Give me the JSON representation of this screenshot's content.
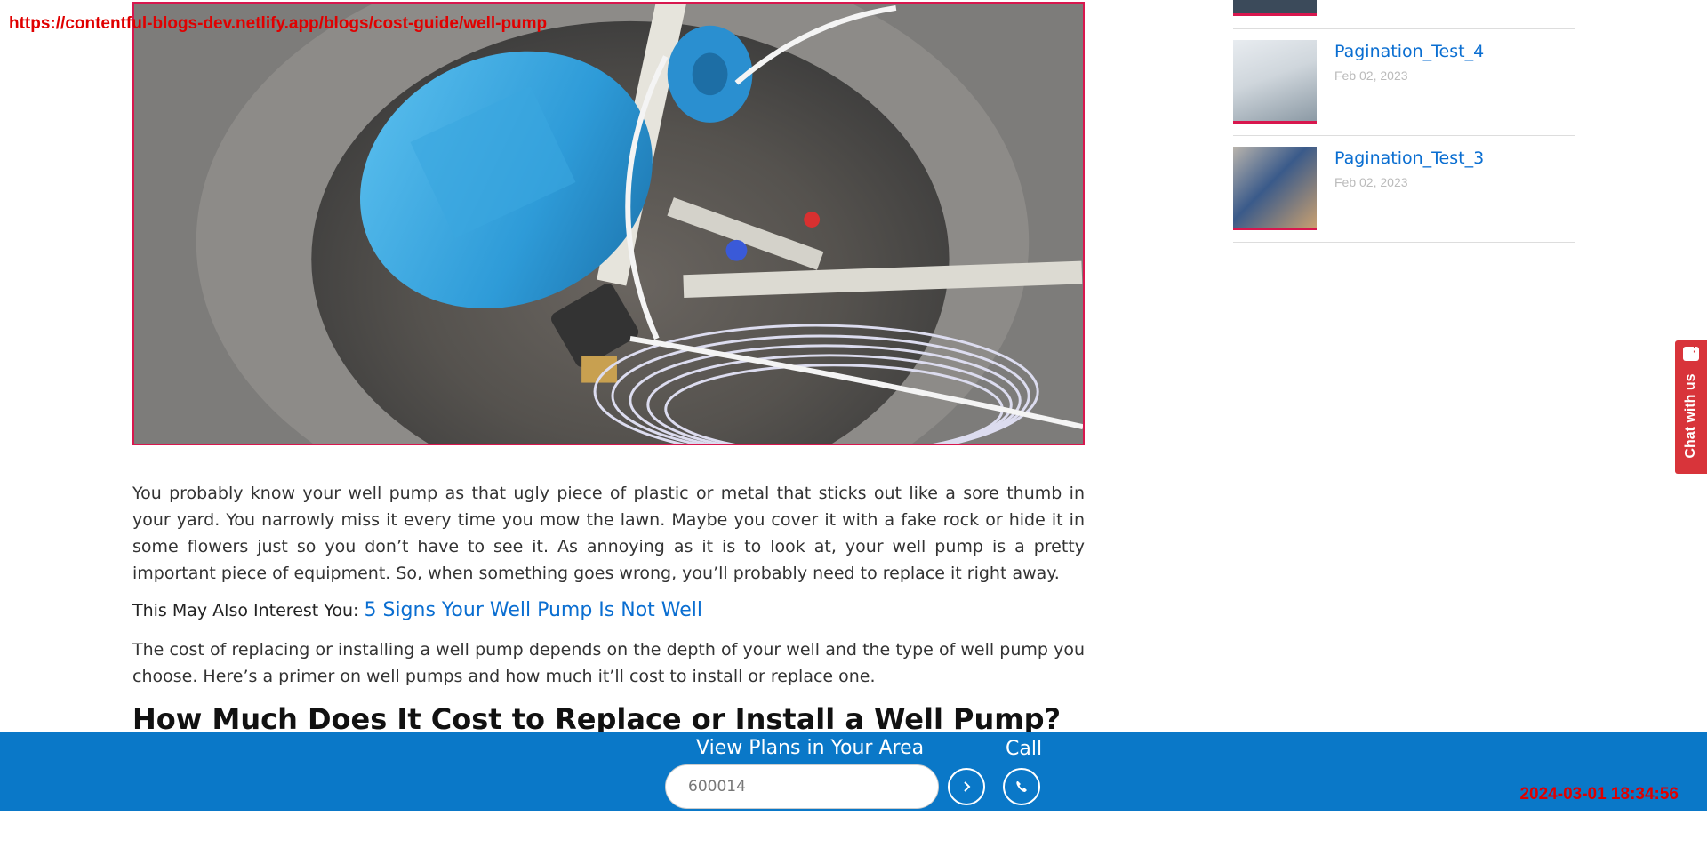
{
  "browser": {
    "url": "https://contentful-blogs-dev.netlify.app/blogs/cost-guide/well-pump",
    "timestamp": "2024-03-01 18:34:56"
  },
  "article": {
    "paragraph1": "You probably know your well pump as that ugly piece of plastic or metal that sticks out like a sore thumb in your yard. You narrowly miss it every time you mow the lawn. Maybe you cover it with a fake rock or hide it in some flowers just so you don’t have to see it. As annoying as it is to look at, your well pump is a pretty important piece of equipment. So, when something goes wrong, you’ll probably need to replace it right away.",
    "interest_label": "This May Also Interest You:",
    "interest_link": "5 Signs Your Well Pump Is Not Well",
    "paragraph2": "The cost of replacing or installing a well pump depends on the depth of your well and the type of well pump you choose. Here’s a primer on well pumps and how much it’ll cost to install or replace one.",
    "heading": "How Much Does It Cost to Replace or Install a Well Pump?"
  },
  "sidebar": {
    "items": [
      {
        "title": "Pagination_Test_4",
        "date": "Feb 02, 2023"
      },
      {
        "title": "Pagination_Test_3",
        "date": "Feb 02, 2023"
      }
    ]
  },
  "chat": {
    "label": "Chat with us"
  },
  "bottom_bar": {
    "plans_label": "View Plans in Your Area",
    "zip_value": "600014",
    "call_label": "Call"
  },
  "icons": {
    "go": "chevron-right-icon",
    "call": "phone-icon",
    "chat": "chat-bubble-icon"
  },
  "colors": {
    "brand_blue": "#0a78c8",
    "link_blue": "#0a6ed1",
    "accent_red": "#d8174e",
    "chat_red": "#d8343a"
  }
}
